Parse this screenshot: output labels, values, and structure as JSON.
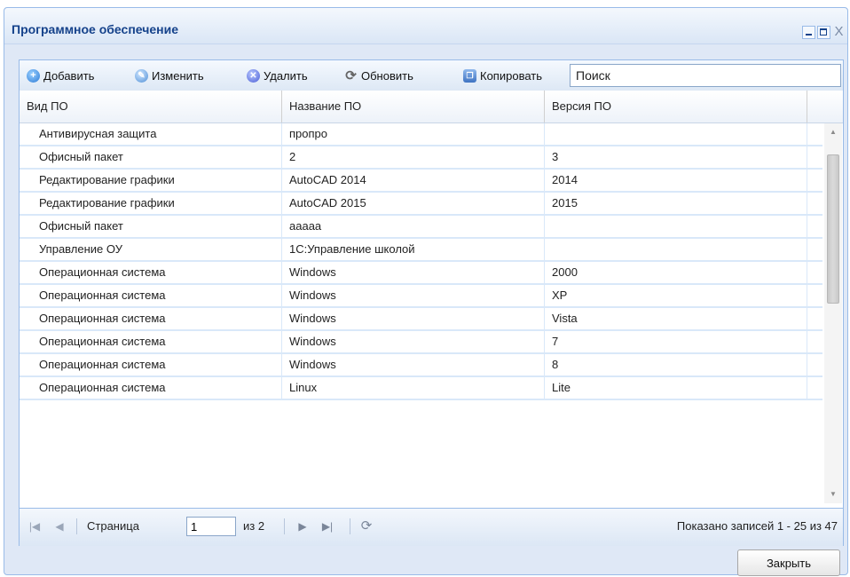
{
  "window": {
    "title": "Программное обеспечение",
    "close_glyph": "X"
  },
  "toolbar": {
    "add_label": "Добавить",
    "edit_label": "Изменить",
    "delete_label": "Удалить",
    "refresh_label": "Обновить",
    "copy_label": "Копировать",
    "search_value": "Поиск"
  },
  "grid": {
    "columns": [
      "Вид ПО",
      "Название ПО",
      "Версия ПО"
    ],
    "rows": [
      [
        "Антивирусная защита",
        "пропро",
        ""
      ],
      [
        "Офисный пакет",
        "2",
        "3"
      ],
      [
        "Редактирование графики",
        "AutoCAD 2014",
        "2014"
      ],
      [
        "Редактирование графики",
        "AutoCAD 2015",
        "2015"
      ],
      [
        "Офисный пакет",
        "ааааа",
        ""
      ],
      [
        "Управление ОУ",
        "1С:Управление школой",
        ""
      ],
      [
        "Операционная система",
        "Windows",
        "2000"
      ],
      [
        "Операционная система",
        "Windows",
        "XP"
      ],
      [
        "Операционная система",
        "Windows",
        "Vista"
      ],
      [
        "Операционная система",
        "Windows",
        "7"
      ],
      [
        "Операционная система",
        "Windows",
        "8"
      ],
      [
        "Операционная система",
        "Linux",
        "Lite"
      ]
    ]
  },
  "pager": {
    "page_label": "Страница",
    "page_value": "1",
    "of_label": "из 2",
    "status": "Показано записей 1 - 25 из 47"
  },
  "footer": {
    "close_label": "Закрыть"
  },
  "icons": {
    "add": "plus-circle-icon",
    "edit": "pencil-icon",
    "delete": "x-circle-icon",
    "refresh": "refresh-icon",
    "copy": "copy-icon"
  },
  "colors": {
    "title_text": "#15428b",
    "border": "#99bbe8",
    "row_separator": "#d9e8f9"
  }
}
